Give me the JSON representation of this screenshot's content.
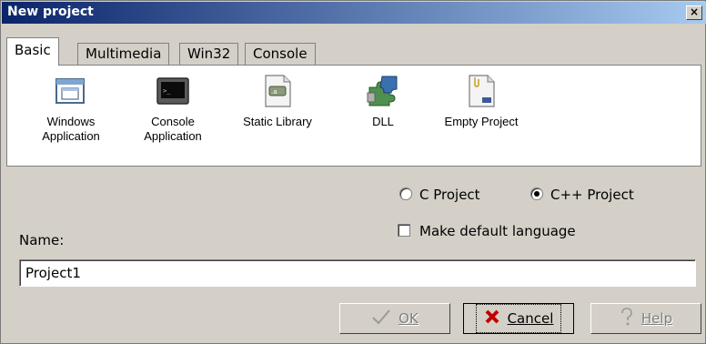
{
  "window": {
    "title": "New project",
    "close_label": "×"
  },
  "tabs": [
    {
      "label": "Basic",
      "active": true
    },
    {
      "label": "Multimedia",
      "active": false
    },
    {
      "label": "Win32",
      "active": false
    },
    {
      "label": "Console",
      "active": false
    }
  ],
  "projects": [
    {
      "label": "Windows\nApplication",
      "icon": "windows-app-icon"
    },
    {
      "label": "Console\nApplication",
      "icon": "console-app-icon"
    },
    {
      "label": "Static Library",
      "icon": "static-library-icon"
    },
    {
      "label": "DLL",
      "icon": "dll-puzzle-icon"
    },
    {
      "label": "Empty Project",
      "icon": "empty-project-icon"
    }
  ],
  "language": {
    "c_label": "C Project",
    "cpp_label": "C++ Project",
    "selected": "C++ Project",
    "default_label": "Make default language",
    "default_checked": false
  },
  "name": {
    "label": "Name:",
    "value": "Project1"
  },
  "buttons": {
    "ok_label": "OK",
    "cancel_label": "Cancel",
    "help_label": "Help"
  }
}
